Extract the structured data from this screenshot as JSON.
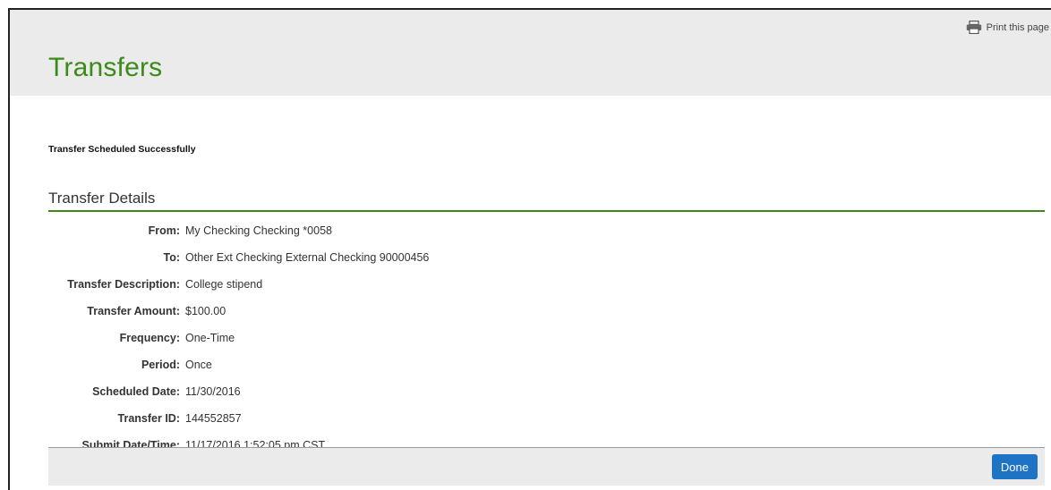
{
  "header": {
    "print_label": "Print this page",
    "print_icon": "printer-icon",
    "title": "Transfers"
  },
  "status": {
    "message": "Transfer Scheduled Successfully"
  },
  "details": {
    "section_title": "Transfer Details",
    "rows": [
      {
        "label": "From:",
        "value": "My Checking Checking *0058"
      },
      {
        "label": "To:",
        "value": "Other Ext Checking External Checking 90000456"
      },
      {
        "label": "Transfer Description:",
        "value": "College stipend"
      },
      {
        "label": "Transfer Amount:",
        "value": "$100.00"
      },
      {
        "label": "Frequency:",
        "value": "One-Time"
      },
      {
        "label": "Period:",
        "value": "Once"
      },
      {
        "label": "Scheduled Date:",
        "value": "11/30/2016"
      },
      {
        "label": "Transfer ID:",
        "value": "144552857"
      },
      {
        "label": "Submit Date/Time:",
        "value": "11/17/2016 1:52:05 pm CST"
      }
    ]
  },
  "footer": {
    "done_label": "Done"
  },
  "colors": {
    "accent_green": "#3b8a1a",
    "primary_blue": "#1f73c4",
    "header_bg": "#ebebeb"
  }
}
